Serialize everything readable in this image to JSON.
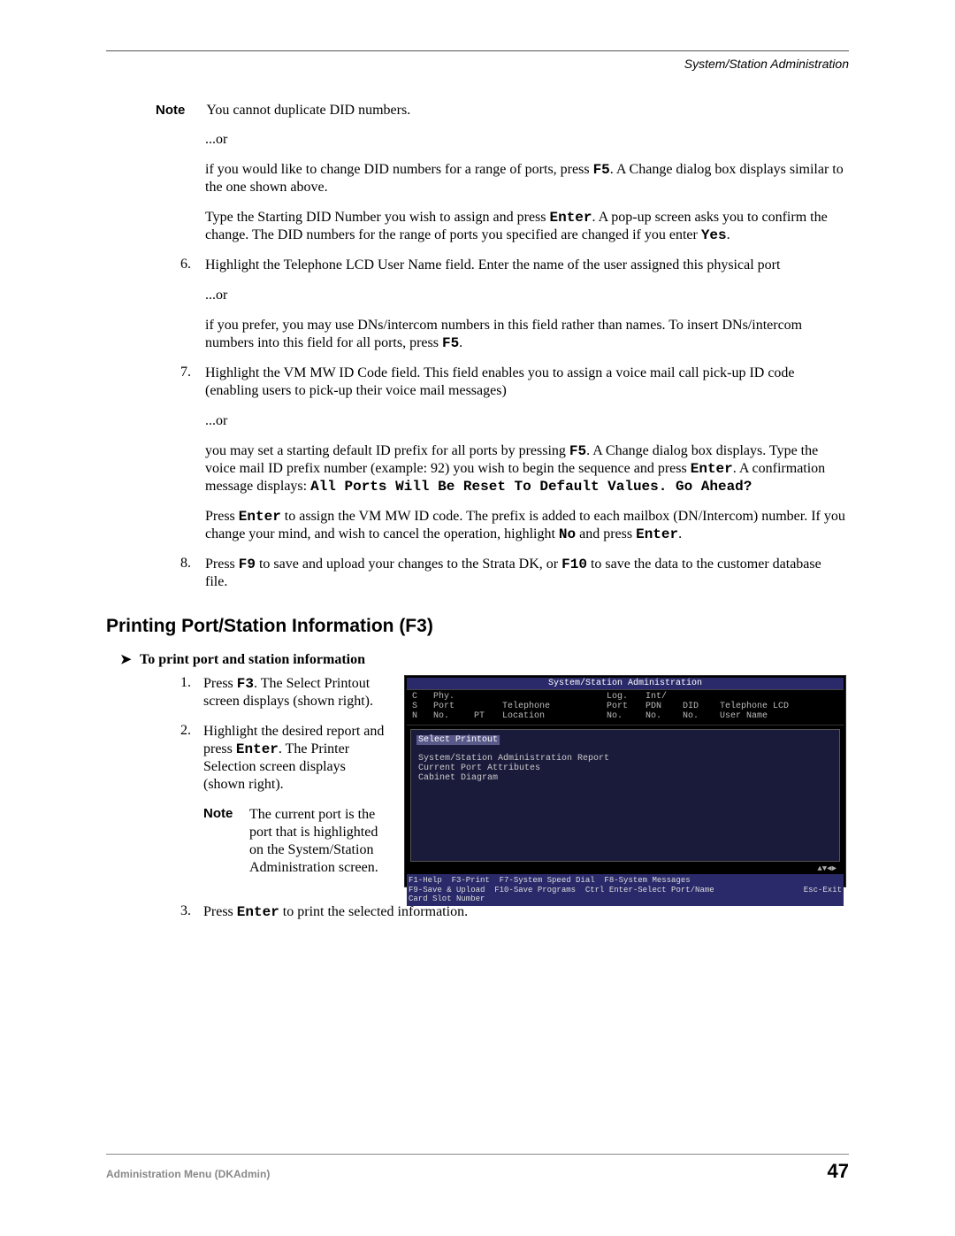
{
  "header": {
    "title": "System/Station Administration"
  },
  "note1": {
    "label": "Note",
    "text": "You cannot duplicate DID numbers."
  },
  "p_or1": "...or",
  "p1a": "if you would like to change DID numbers for a range of ports, press ",
  "k_f5": "F5",
  "p1b": ". A Change dialog box displays similar to the one shown above.",
  "p2a": "Type the Starting DID Number you wish to assign and press ",
  "k_enter": "Enter",
  "p2b": ". A pop-up screen asks you to confirm the change. The DID numbers for the range of ports you specified are changed if you enter ",
  "k_yes": "Yes",
  "period": ".",
  "li6": {
    "num": "6.",
    "text": "Highlight the Telephone LCD User Name field. Enter the name of the user assigned this physical port"
  },
  "p_or2": "...or",
  "p3a": "if you prefer, you may use DNs/intercom numbers in this field rather than names. To insert DNs/intercom numbers into this field for all ports, press ",
  "li7": {
    "num": "7.",
    "text": "Highlight the VM MW ID Code field. This field enables you to assign a voice mail call pick-up ID code (enabling users to pick-up their voice mail messages)"
  },
  "p_or3": "...or",
  "p4a": "you may set a starting default ID prefix for all ports by pressing ",
  "p4b": ". A Change dialog box displays. Type the voice mail ID prefix number (example: 92) you wish to begin the sequence and press ",
  "p4c": ". A confirmation message displays: ",
  "k_allports": "All Ports Will Be Reset To Default Values. Go Ahead?",
  "p5a": "Press ",
  "p5b": " to assign the VM MW ID code. The prefix is added to each mailbox (DN/Intercom) number. If you change your mind, and wish to cancel the operation, highlight ",
  "k_no": "No",
  "p5c": " and press ",
  "li8": {
    "num": "8.",
    "a": "Press ",
    "k_f9": "F9",
    "b": " to save and upload your changes to the Strata DK, or ",
    "k_f10": "F10",
    "c": " to save the data to the customer database file."
  },
  "h2": "Printing Port/Station Information (F3)",
  "proc": {
    "arrow": "➤",
    "text": "To print port and station information"
  },
  "s1": {
    "num": "1.",
    "a": "Press ",
    "k": "F3",
    "b": ". The Select Printout screen displays (shown right)."
  },
  "s2": {
    "num": "2.",
    "a": "Highlight the desired report and press ",
    "k": "Enter",
    "b": ". The Printer Selection screen displays (shown right)."
  },
  "snote": {
    "label": "Note",
    "text": "The current port is the port that is highlighted on the System/Station Administration screen."
  },
  "s3": {
    "num": "3.",
    "a": "Press ",
    "k": "Enter",
    "b": " to print the selected information."
  },
  "terminal": {
    "title": "System/Station Administration",
    "cols": {
      "csn": "C\nS\nN",
      "phy": "Phy.\nPort\nNo.",
      "pt": "PT",
      "loc": "Telephone\nLocation",
      "log": "Log.\nPort\nNo.",
      "pdn": "Int/\nPDN\nNo.",
      "did": "DID\nNo.",
      "lcd": "Telephone LCD\nUser Name"
    },
    "select_label": "Select Printout",
    "options": [
      "System/Station Administration Report",
      "Current Port Attributes",
      "Cabinet Diagram"
    ],
    "scroll": "▲▼◄►",
    "footer1": "F1-Help  F3-Print  F7-System Speed Dial  F8-System Messages",
    "footer2": "F9-Save & Upload  F10-Save Programs  Ctrl Enter-Select Port/Name",
    "esc": "Esc-Exit",
    "footer3": "Card Slot Number"
  },
  "footer": {
    "left": "Administration Menu (DKAdmin)",
    "right": "47"
  }
}
